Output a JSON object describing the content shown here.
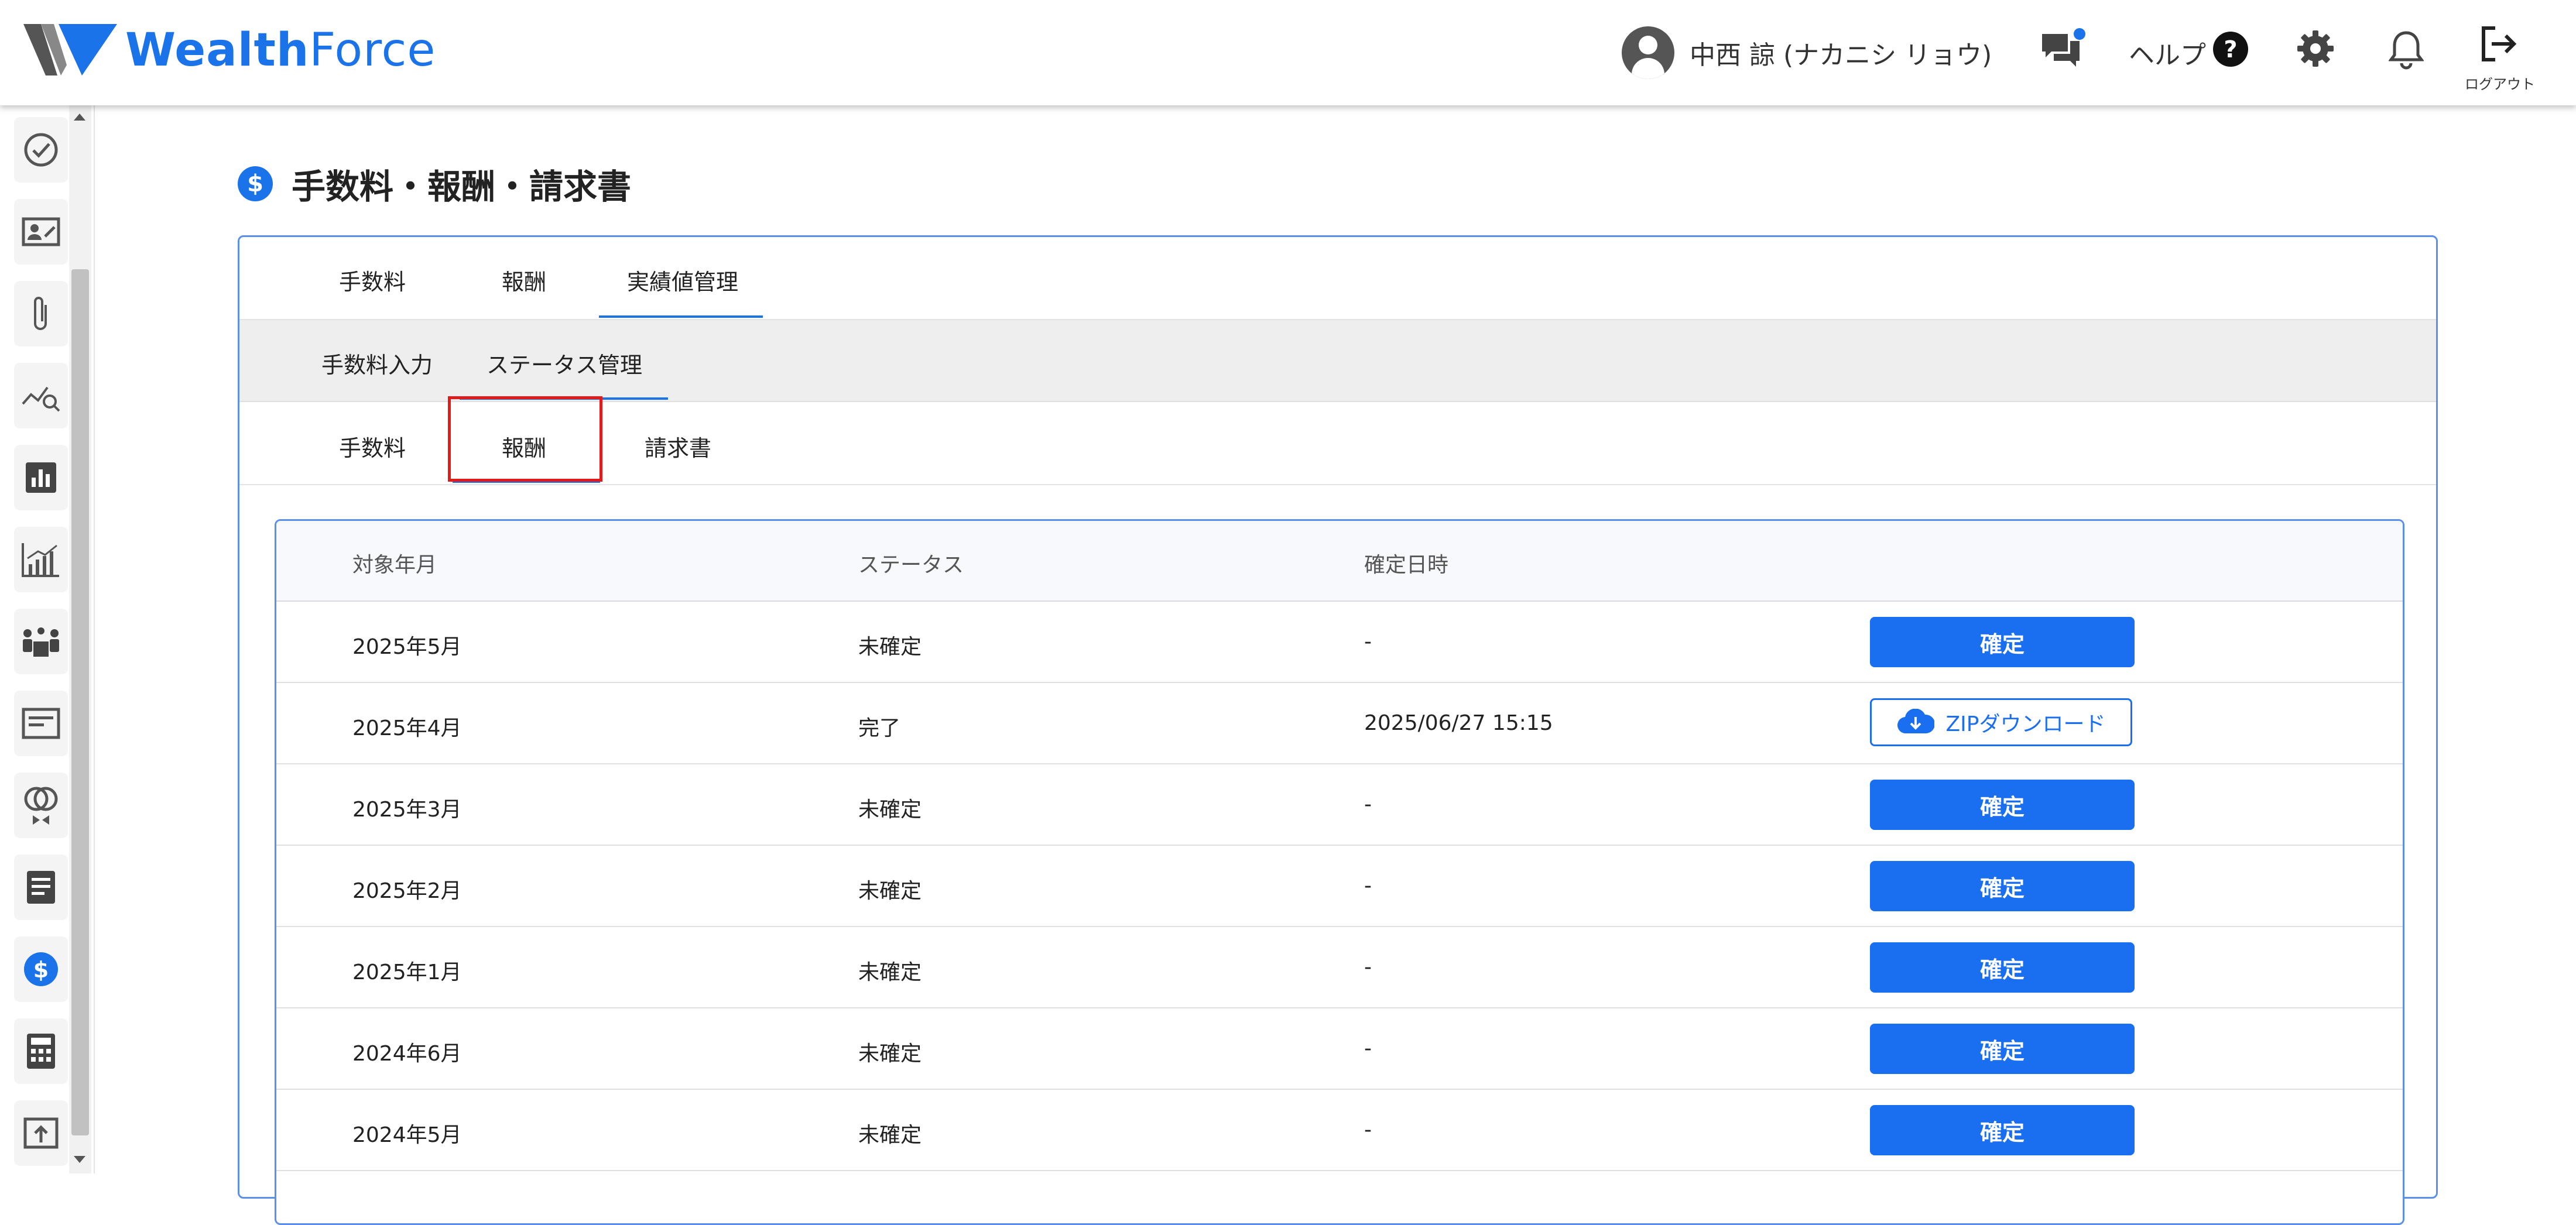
{
  "app": {
    "logo_text_bold": "Wealth",
    "logo_text_light": "Force",
    "brand_color": "#1a73e8"
  },
  "header": {
    "user_name": "中西 諒 (ナカニシ リョウ)",
    "help_label": "ヘルプ",
    "logout_label": "ログアウト",
    "icons": [
      "user-avatar-icon",
      "chat-icon",
      "help-icon",
      "gear-icon",
      "bell-icon",
      "logout-icon"
    ]
  },
  "sidebar": {
    "items": [
      {
        "icon": "check-circle-icon"
      },
      {
        "icon": "id-card-edit-icon"
      },
      {
        "icon": "paperclip-icon"
      },
      {
        "icon": "chart-search-icon"
      },
      {
        "icon": "bar-chart-box-icon"
      },
      {
        "icon": "growth-chart-icon"
      },
      {
        "icon": "meeting-icon"
      },
      {
        "icon": "card-icon"
      },
      {
        "icon": "rings-icon"
      },
      {
        "icon": "document-icon"
      },
      {
        "icon": "dollar-icon",
        "active": true
      },
      {
        "icon": "calculator-icon"
      },
      {
        "icon": "upload-box-icon"
      }
    ]
  },
  "page": {
    "title": "手数料・報酬・請求書",
    "tabs_level1": [
      {
        "label": "手数料"
      },
      {
        "label": "報酬"
      },
      {
        "label": "実績値管理",
        "active": true
      }
    ],
    "tabs_level2": [
      {
        "label": "手数料入力"
      },
      {
        "label": "ステータス管理",
        "active": true
      }
    ],
    "tabs_level3": [
      {
        "label": "手数料"
      },
      {
        "label": "報酬",
        "active": true
      },
      {
        "label": "請求書"
      }
    ]
  },
  "table": {
    "columns": [
      "対象年月",
      "ステータス",
      "確定日時"
    ],
    "confirm_label": "確定",
    "zip_label": "ZIPダウンロード",
    "rows": [
      {
        "month": "2025年5月",
        "status": "未確定",
        "confirmed_at": "-",
        "action": "confirm"
      },
      {
        "month": "2025年4月",
        "status": "完了",
        "confirmed_at": "2025/06/27 15:15",
        "action": "zip"
      },
      {
        "month": "2025年3月",
        "status": "未確定",
        "confirmed_at": "-",
        "action": "confirm"
      },
      {
        "month": "2025年2月",
        "status": "未確定",
        "confirmed_at": "-",
        "action": "confirm"
      },
      {
        "month": "2025年1月",
        "status": "未確定",
        "confirmed_at": "-",
        "action": "confirm"
      },
      {
        "month": "2024年6月",
        "status": "未確定",
        "confirmed_at": "-",
        "action": "confirm"
      },
      {
        "month": "2024年5月",
        "status": "未確定",
        "confirmed_at": "-",
        "action": "confirm"
      }
    ]
  }
}
